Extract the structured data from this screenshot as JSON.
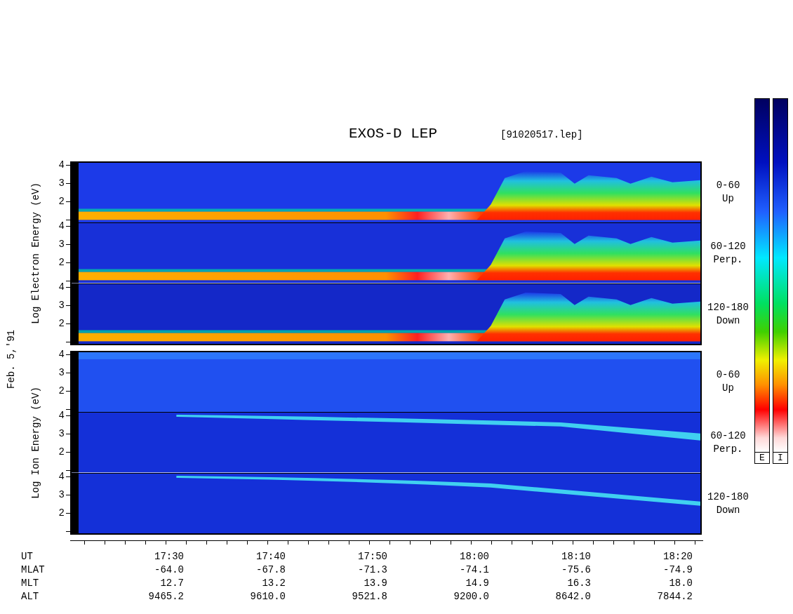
{
  "title": "EXOS-D LEP",
  "file_label": "[91020517.lep]",
  "date_label": "Feb. 5,'91",
  "groups": [
    {
      "kind": "electron",
      "axis_label": "Log Electron Energy (eV)",
      "panels": [
        {
          "yticks": [
            "4",
            "3",
            "2"
          ],
          "pitch": "0-60",
          "direction": "Up"
        },
        {
          "yticks": [
            "4",
            "3",
            "2"
          ],
          "pitch": "60-120",
          "direction": "Perp."
        },
        {
          "yticks": [
            "4",
            "3",
            "2"
          ],
          "pitch": "120-180",
          "direction": "Down"
        }
      ]
    },
    {
      "kind": "ion",
      "axis_label": "Log Ion Energy (eV)",
      "panels": [
        {
          "yticks": [
            "4",
            "3",
            "2"
          ],
          "pitch": "0-60",
          "direction": "Up"
        },
        {
          "yticks": [
            "4",
            "3",
            "2"
          ],
          "pitch": "60-120",
          "direction": "Perp."
        },
        {
          "yticks": [
            "4",
            "3",
            "2"
          ],
          "pitch": "120-180",
          "direction": "Down"
        }
      ]
    }
  ],
  "time_table": [
    {
      "label": "UT",
      "values": [
        "17:30",
        "17:40",
        "17:50",
        "18:00",
        "18:10",
        "18:20"
      ]
    },
    {
      "label": "MLAT",
      "values": [
        "-64.0",
        "-67.8",
        "-71.3",
        "-74.1",
        "-75.6",
        "-74.9"
      ]
    },
    {
      "label": "MLT",
      "values": [
        "12.7",
        "13.2",
        "13.9",
        "14.9",
        "16.3",
        "18.0"
      ]
    },
    {
      "label": "ALT",
      "values": [
        "9465.2",
        "9610.0",
        "9521.8",
        "9200.0",
        "8642.0",
        "7844.2"
      ]
    }
  ],
  "colorbars": [
    {
      "label": "E"
    },
    {
      "label": "I"
    }
  ]
}
